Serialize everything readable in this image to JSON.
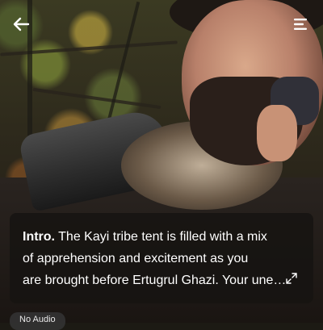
{
  "header": {
    "back_icon": "arrow-left-icon",
    "menu_icon": "hamburger-menu-icon"
  },
  "intro": {
    "label": "Intro.",
    "text": " The Kayi tribe tent is filled with a mix\nof apprehension and excitement as you\nare brought before Ertugrul Ghazi. Your une…",
    "expand_icon": "expand-arrows-icon"
  },
  "audio": {
    "label": "No Audio"
  },
  "colors": {
    "card_background": "#161412",
    "text": "#ffffff"
  }
}
